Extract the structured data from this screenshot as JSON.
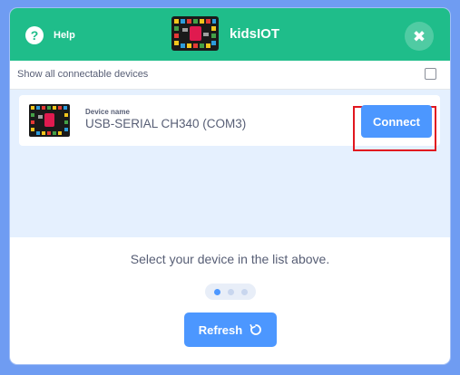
{
  "header": {
    "help_icon_glyph": "?",
    "help_label": "Help",
    "title": "kidsIOT",
    "close_glyph": "✖",
    "background_color": "#1fbd8a"
  },
  "options": {
    "show_all_label": "Show all connectable devices",
    "show_all_checked": false
  },
  "devices": [
    {
      "name_label": "Device name",
      "name_value": "USB-SERIAL CH340 (COM3)",
      "connect_label": "Connect",
      "highlighted": true
    }
  ],
  "footer": {
    "hint": "Select your device in the list above.",
    "step_dots_total": 3,
    "step_dots_active": 1,
    "refresh_label": "Refresh"
  },
  "colors": {
    "accent": "#4c97ff",
    "list_background": "#e5f0fe",
    "highlight_outline": "#e1171f",
    "page_background": "#6f9cf2"
  },
  "icons": {
    "help": "question-circle-icon",
    "close": "close-icon",
    "refresh": "refresh-icon",
    "logo": "kidsiot-board-logo",
    "device": "kidsiot-board-image"
  }
}
